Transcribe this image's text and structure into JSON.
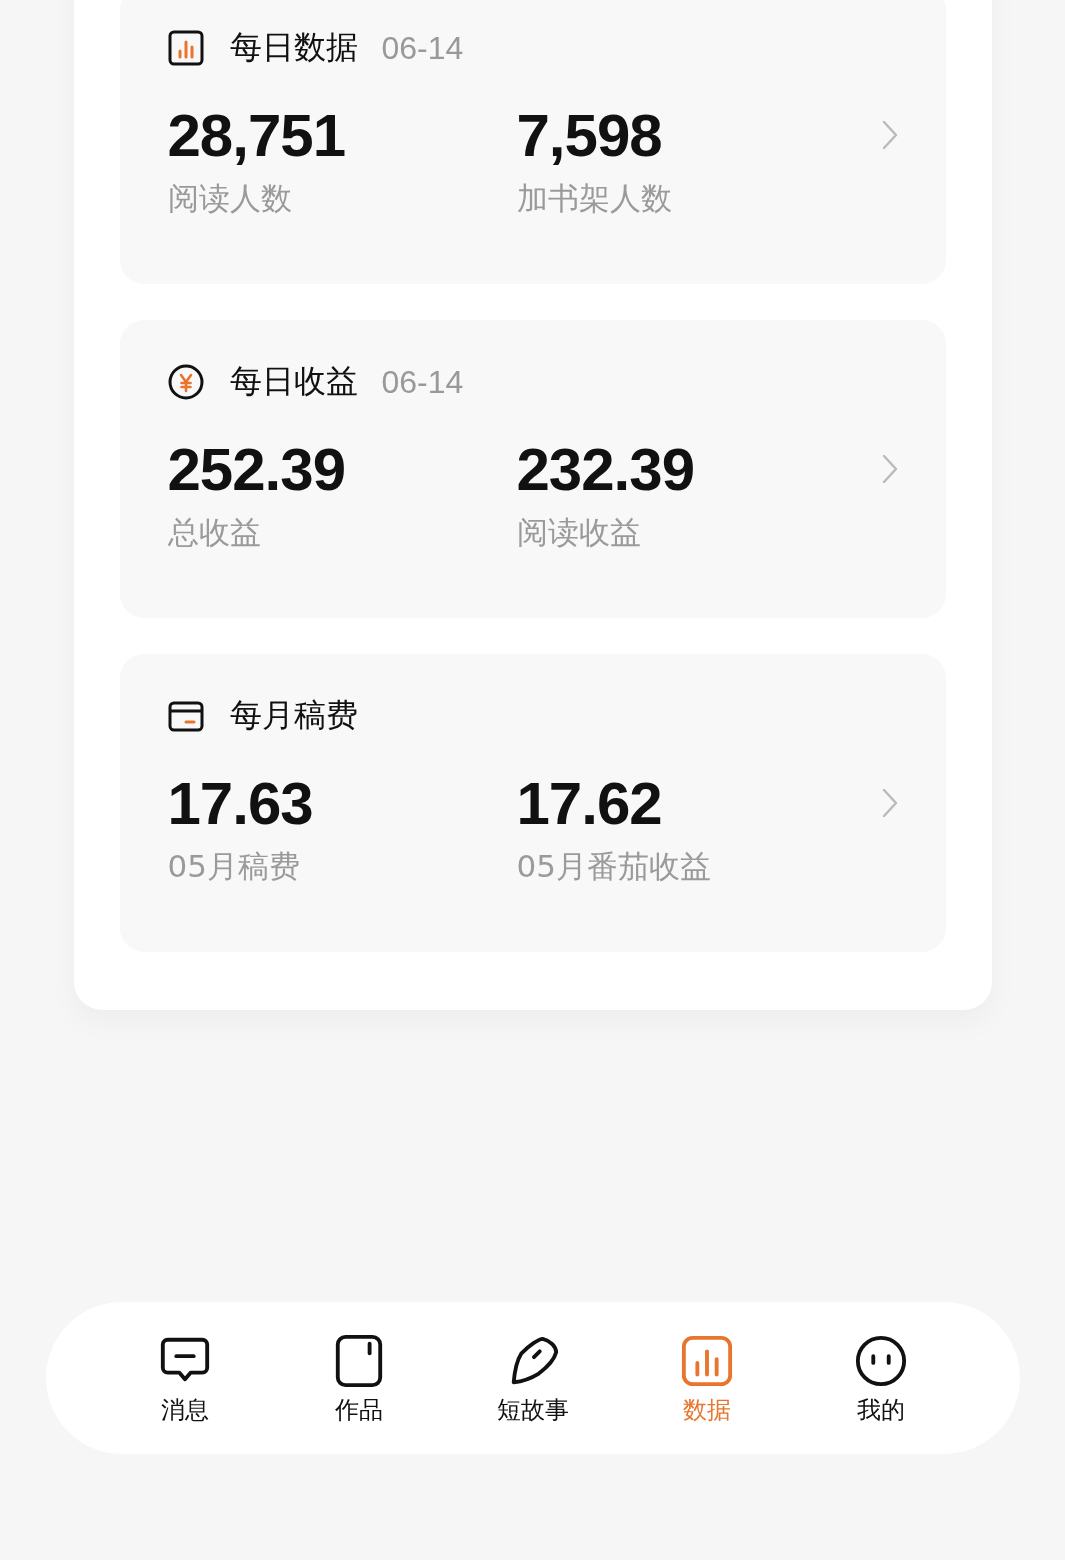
{
  "cards": [
    {
      "title": "每日数据",
      "date": "06-14",
      "stats": [
        {
          "value": "28,751",
          "label": "阅读人数"
        },
        {
          "value": "7,598",
          "label": "加书架人数"
        }
      ]
    },
    {
      "title": "每日收益",
      "date": "06-14",
      "stats": [
        {
          "value": "252.39",
          "label": "总收益"
        },
        {
          "value": "232.39",
          "label": "阅读收益"
        }
      ]
    },
    {
      "title": "每月稿费",
      "stats": [
        {
          "value": "17.63",
          "label": "05月稿费"
        },
        {
          "value": "17.62",
          "label": "05月番茄收益"
        }
      ]
    }
  ],
  "tab_bar": [
    {
      "label": "消息",
      "selected": false
    },
    {
      "label": "作品",
      "selected": false
    },
    {
      "label": "短故事",
      "selected": false
    },
    {
      "label": "数据",
      "selected": true
    },
    {
      "label": "我的",
      "selected": false
    }
  ]
}
